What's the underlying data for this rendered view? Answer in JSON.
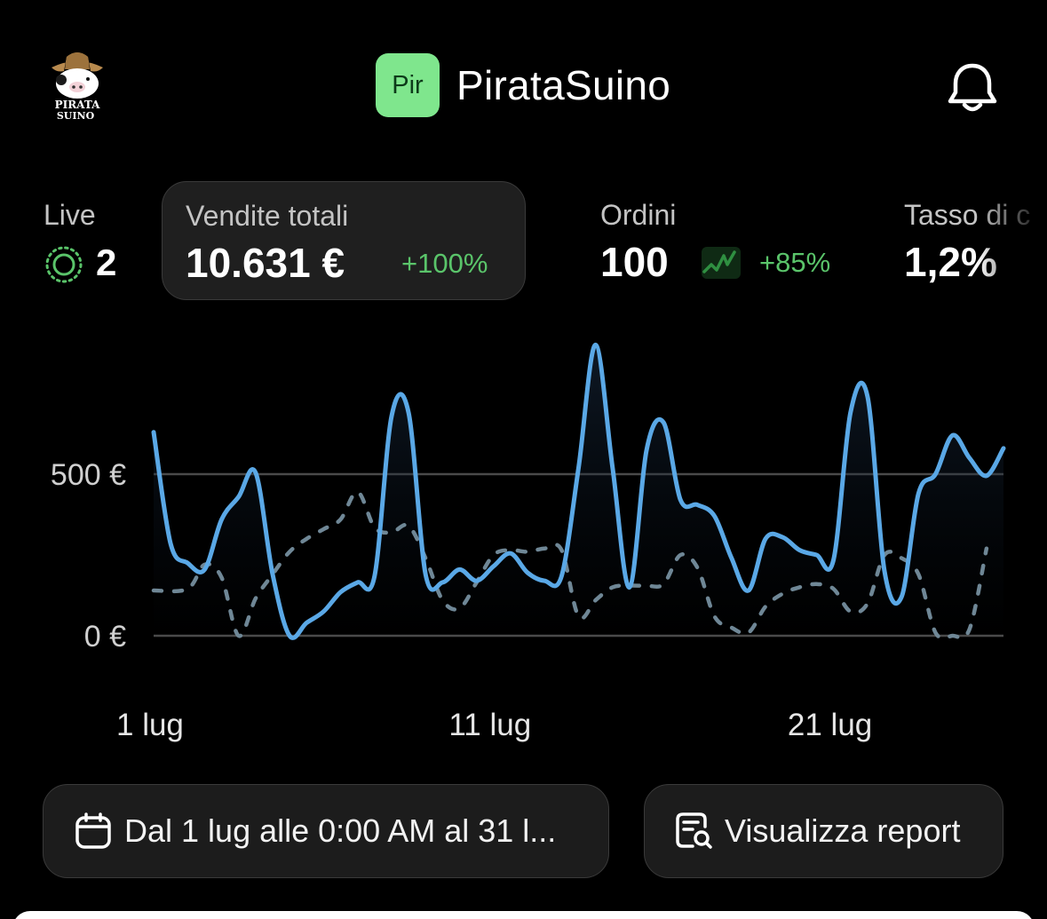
{
  "header": {
    "logo_text_line1": "PIRATA",
    "logo_text_line2": "SUINO",
    "store_badge": "Pir",
    "store_name": "PirataSuino"
  },
  "metrics": {
    "live": {
      "label": "Live",
      "value": "2"
    },
    "sales": {
      "label": "Vendite totali",
      "value": "10.631 €",
      "delta": "+100%"
    },
    "orders": {
      "label": "Ordini",
      "value": "100",
      "delta": "+85%"
    },
    "conversion": {
      "label": "Tasso di c",
      "value": "1,2%"
    }
  },
  "chart_data": {
    "type": "line",
    "ylim": [
      0,
      1000
    ],
    "y_ticks": [
      {
        "value": 0,
        "label": "0 €"
      },
      {
        "value": 500,
        "label": "500 €"
      }
    ],
    "x_ticks": [
      {
        "day": 1,
        "label": "1 lug"
      },
      {
        "day": 11,
        "label": "11 lug"
      },
      {
        "day": 21,
        "label": "21 lug"
      }
    ],
    "grid": true,
    "series": [
      {
        "style": "solid",
        "color": "#5aa8e6",
        "points": [
          [
            1.0,
            630
          ],
          [
            1.5,
            285
          ],
          [
            2.0,
            225
          ],
          [
            2.5,
            205
          ],
          [
            3.0,
            360
          ],
          [
            3.5,
            430
          ],
          [
            4.0,
            505
          ],
          [
            4.5,
            190
          ],
          [
            5.0,
            0
          ],
          [
            5.5,
            40
          ],
          [
            6.0,
            75
          ],
          [
            6.5,
            135
          ],
          [
            7.0,
            165
          ],
          [
            7.5,
            185
          ],
          [
            8.0,
            680
          ],
          [
            8.5,
            690
          ],
          [
            9.0,
            190
          ],
          [
            9.5,
            165
          ],
          [
            10.0,
            205
          ],
          [
            10.5,
            170
          ],
          [
            11.0,
            215
          ],
          [
            11.5,
            255
          ],
          [
            12.0,
            195
          ],
          [
            12.5,
            170
          ],
          [
            13.0,
            185
          ],
          [
            13.5,
            520
          ],
          [
            14.0,
            900
          ],
          [
            14.5,
            520
          ],
          [
            15.0,
            150
          ],
          [
            15.5,
            575
          ],
          [
            16.0,
            660
          ],
          [
            16.5,
            420
          ],
          [
            17.0,
            405
          ],
          [
            17.5,
            370
          ],
          [
            18.0,
            240
          ],
          [
            18.5,
            140
          ],
          [
            19.0,
            300
          ],
          [
            19.5,
            305
          ],
          [
            20.0,
            265
          ],
          [
            20.5,
            250
          ],
          [
            21.0,
            235
          ],
          [
            21.5,
            690
          ],
          [
            22.0,
            740
          ],
          [
            22.5,
            200
          ],
          [
            23.0,
            120
          ],
          [
            23.5,
            440
          ],
          [
            24.0,
            500
          ],
          [
            24.5,
            620
          ],
          [
            25.0,
            550
          ],
          [
            25.5,
            495
          ],
          [
            26.0,
            580
          ]
        ]
      },
      {
        "style": "dashed",
        "color": "#6f8796",
        "points": [
          [
            1.0,
            140
          ],
          [
            2.0,
            145
          ],
          [
            2.5,
            220
          ],
          [
            3.0,
            180
          ],
          [
            3.5,
            0
          ],
          [
            4.0,
            115
          ],
          [
            4.5,
            190
          ],
          [
            5.0,
            260
          ],
          [
            5.5,
            300
          ],
          [
            6.0,
            330
          ],
          [
            6.5,
            360
          ],
          [
            7.0,
            445
          ],
          [
            7.5,
            335
          ],
          [
            8.0,
            320
          ],
          [
            8.5,
            340
          ],
          [
            9.0,
            240
          ],
          [
            9.5,
            110
          ],
          [
            10.0,
            85
          ],
          [
            10.5,
            165
          ],
          [
            11.0,
            250
          ],
          [
            11.5,
            265
          ],
          [
            12.0,
            260
          ],
          [
            12.5,
            270
          ],
          [
            13.0,
            265
          ],
          [
            13.5,
            60
          ],
          [
            14.0,
            110
          ],
          [
            14.5,
            150
          ],
          [
            15.0,
            155
          ],
          [
            15.5,
            155
          ],
          [
            16.0,
            160
          ],
          [
            16.5,
            250
          ],
          [
            17.0,
            210
          ],
          [
            17.5,
            60
          ],
          [
            18.0,
            25
          ],
          [
            18.5,
            10
          ],
          [
            19.0,
            90
          ],
          [
            19.5,
            130
          ],
          [
            20.0,
            150
          ],
          [
            20.5,
            160
          ],
          [
            21.0,
            145
          ],
          [
            21.5,
            75
          ],
          [
            22.0,
            100
          ],
          [
            22.5,
            250
          ],
          [
            23.0,
            240
          ],
          [
            23.5,
            190
          ],
          [
            24.0,
            10
          ],
          [
            24.5,
            0
          ],
          [
            25.0,
            20
          ],
          [
            25.5,
            270
          ]
        ]
      }
    ]
  },
  "buttons": {
    "date_range": "Dal 1 lug alle 0:00 AM al 31 l...",
    "report": "Visualizza report"
  },
  "colors": {
    "accent_blue": "#5aa8e6",
    "positive_green": "#5ac46a",
    "badge_green": "#7fe68d",
    "card_bg": "#1f1f1f"
  },
  "icons": {
    "logo": "pig-pirate-logo",
    "bell": "bell-icon",
    "live": "live-pulse-icon",
    "sparkline": "sparkline-icon",
    "calendar": "calendar-icon",
    "report": "report-search-icon"
  }
}
